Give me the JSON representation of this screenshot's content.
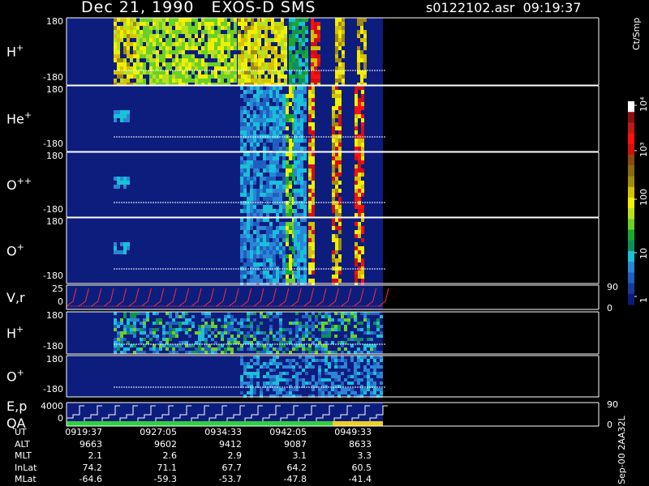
{
  "header": {
    "title": "Dec 21, 1990   EXOS-D SMS",
    "file": "s0122102.asr  09:19:37"
  },
  "colorbar": {
    "label": "Ct/Smp",
    "ticks": [
      "1",
      "10",
      "100",
      "10³",
      "10⁴"
    ],
    "colors": [
      "#0d1a7a",
      "#1a3a9a",
      "#1f5fc0",
      "#2a86d6",
      "#19c0d8",
      "#0f8f5a",
      "#1aa830",
      "#6cd027",
      "#b8e020",
      "#f0f000",
      "#d6c000",
      "#a08a10",
      "#8a6a10",
      "#8a4a10",
      "#d21010",
      "#ff1010",
      "#c01818",
      "#8a1010",
      "#ffffff"
    ]
  },
  "chart_data": {
    "type": "heatmap",
    "x_range": [
      "09:19:37",
      "09:49:33"
    ],
    "panels": [
      {
        "label": "H",
        "sup": "+",
        "ymax": "180",
        "ymin": "-180"
      },
      {
        "label": "He",
        "sup": "+",
        "ymax": "180",
        "ymin": "-180"
      },
      {
        "label": "O",
        "sup": "++",
        "ymax": "180",
        "ymin": "-180"
      },
      {
        "label": "O",
        "sup": "+",
        "ymax": "180",
        "ymin": "-180"
      },
      {
        "label": "V,r",
        "sup": "",
        "ymax": "25",
        "ymin": "0",
        "right_top": "90",
        "right_bottom": "0"
      },
      {
        "label": "H",
        "sup": "+",
        "ymax": "180",
        "ymin": "-180"
      },
      {
        "label": "O",
        "sup": "+",
        "ymax": "180",
        "ymin": "-180"
      },
      {
        "label": "E,p",
        "label2": "QA",
        "sup": "",
        "ymax": "4000",
        "ymin": "0",
        "right_top": "90",
        "right_bottom": "0"
      }
    ]
  },
  "footer": {
    "rows": [
      {
        "label": "UT",
        "values": [
          "0919:37",
          "0927:05",
          "0934:33",
          "0942:05",
          "0949:33"
        ]
      },
      {
        "label": "ALT",
        "values": [
          "9663",
          "9602",
          "9412",
          "9087",
          "8633"
        ]
      },
      {
        "label": "MLT",
        "values": [
          "2.1",
          "2.6",
          "2.9",
          "3.1",
          "3.3"
        ]
      },
      {
        "label": "InLat",
        "values": [
          "74.2",
          "71.1",
          "67.7",
          "64.2",
          "60.5"
        ]
      },
      {
        "label": "MLat",
        "values": [
          "-64.6",
          "-59.3",
          "-53.7",
          "-47.8",
          "-41.4"
        ]
      }
    ]
  },
  "stamp": "Sep-00 2AA32L"
}
